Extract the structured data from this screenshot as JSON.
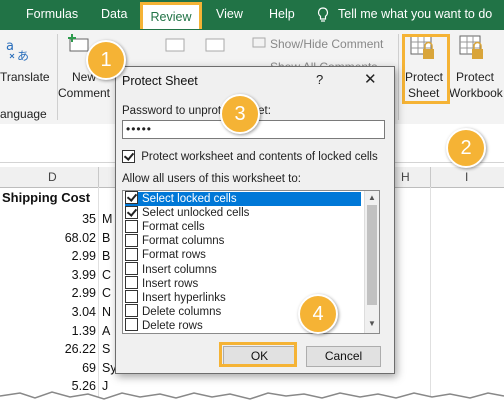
{
  "ribbon_tabs": [
    "Formulas",
    "Data",
    "Review",
    "View",
    "Help"
  ],
  "tell_me": "Tell me what you want to do",
  "ribbon": {
    "translate_label": "Translate",
    "language_group": "anguage",
    "new_comment_line1": "New",
    "new_comment_line2": "Comment",
    "show_hide_comment": "Show/Hide Comment",
    "show_all_comments": "Show All Comments",
    "protect_sheet_line1": "Protect",
    "protect_sheet_line2": "Sheet",
    "protect_workbook_line1": "Protect",
    "protect_workbook_line2": "Workbook"
  },
  "grid": {
    "col_d": "D",
    "col_h": "H",
    "col_i": "I",
    "header": "Shipping Cost",
    "values": [
      "35",
      "68.02",
      "2.99",
      "3.99",
      "2.99",
      "3.04",
      "1.39",
      "26.22",
      "69",
      "5.26"
    ],
    "names": [
      "M",
      "B",
      "B",
      "C",
      "C",
      "N",
      "A",
      "S",
      "Sylvia Foulston",
      "J"
    ]
  },
  "dialog": {
    "title": "Protect Sheet",
    "help": "?",
    "close": "✕",
    "password_label": "Password to unprotect sheet:",
    "password_value": "•••••",
    "protect_label": "Protect worksheet and contents of locked cells",
    "allow_label": "Allow all users of this worksheet to:",
    "options": [
      {
        "label": "Select locked cells",
        "checked": true
      },
      {
        "label": "Select unlocked cells",
        "checked": true
      },
      {
        "label": "Format cells",
        "checked": false
      },
      {
        "label": "Format columns",
        "checked": false
      },
      {
        "label": "Format rows",
        "checked": false
      },
      {
        "label": "Insert columns",
        "checked": false
      },
      {
        "label": "Insert rows",
        "checked": false
      },
      {
        "label": "Insert hyperlinks",
        "checked": false
      },
      {
        "label": "Delete columns",
        "checked": false
      },
      {
        "label": "Delete rows",
        "checked": false
      }
    ],
    "ok": "OK",
    "cancel": "Cancel"
  },
  "callouts": [
    "1",
    "2",
    "3",
    "4"
  ],
  "colors": {
    "excel_green": "#217346",
    "callout": "#f5b335",
    "selection": "#0078d7"
  }
}
